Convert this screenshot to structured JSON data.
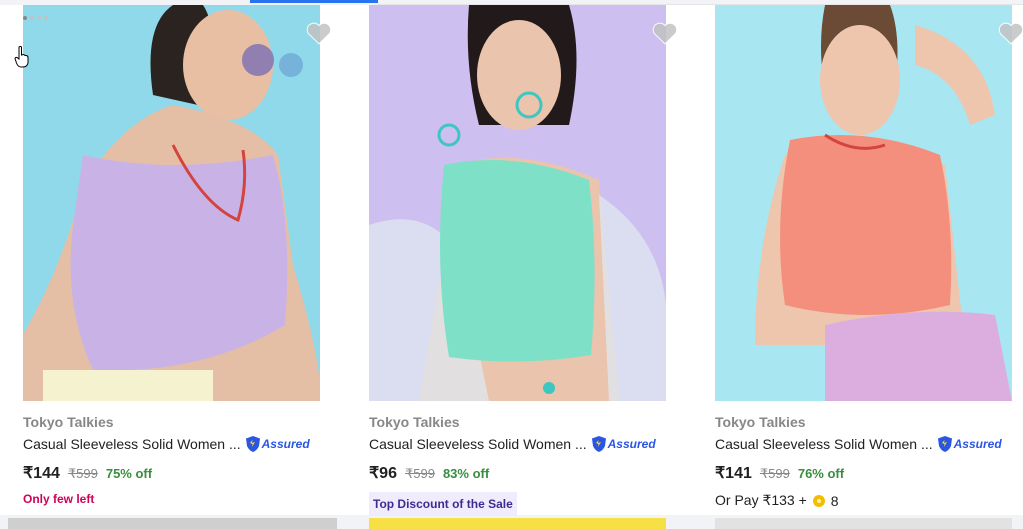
{
  "products": [
    {
      "brand": "Tokyo Talkies",
      "title": "Casual Sleeveless Solid Women ...",
      "assured_label": "Assured",
      "price": "₹144",
      "mrp": "₹599",
      "discount": "75% off",
      "note": "Only few left",
      "image_bg": "#8fd9ea",
      "top_color": "#c9b3e6"
    },
    {
      "brand": "Tokyo Talkies",
      "title": "Casual Sleeveless Solid Women ...",
      "assured_label": "Assured",
      "price": "₹96",
      "mrp": "₹599",
      "discount": "83% off",
      "note": "Top Discount of the Sale",
      "image_bg": "#cdbff0",
      "top_color": "#7fe0c8"
    },
    {
      "brand": "Tokyo Talkies",
      "title": "Casual Sleeveless Solid Women ...",
      "assured_label": "Assured",
      "price": "₹141",
      "mrp": "₹599",
      "discount": "76% off",
      "note_prefix": "Or Pay ₹133 +",
      "note_suffix": "8",
      "image_bg": "#a8e6f2",
      "top_color": "#f58f7d"
    }
  ],
  "colors": {
    "accent": "#2874f0",
    "discount": "#388e3c",
    "assured": "#2a55e5",
    "few_left": "#d1005b"
  },
  "icons": [
    "heart-icon",
    "assured-badge-icon",
    "supercoin-icon",
    "hand-cursor-icon"
  ]
}
